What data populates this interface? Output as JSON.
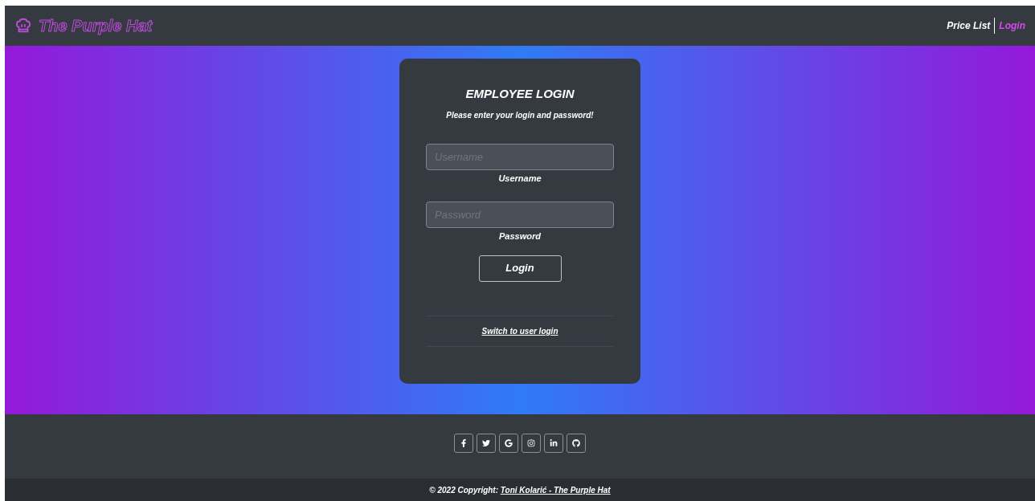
{
  "navbar": {
    "brand": "The Purple Hat",
    "links": [
      {
        "label": "Price List",
        "selected": false
      },
      {
        "label": "Login",
        "selected": true
      }
    ]
  },
  "login_card": {
    "title": "EMPLOYEE LOGIN",
    "subtitle": "Please enter your login and password!",
    "fields": [
      {
        "placeholder": "Username",
        "label": "Username"
      },
      {
        "placeholder": "Password",
        "label": "Password"
      }
    ],
    "button": "Login",
    "switch_link": "Switch to user login"
  },
  "footer": {
    "copyright_prefix": "© 2022 Copyright: ",
    "copyright_link": "Toni Kolarić - The Purple Hat"
  }
}
